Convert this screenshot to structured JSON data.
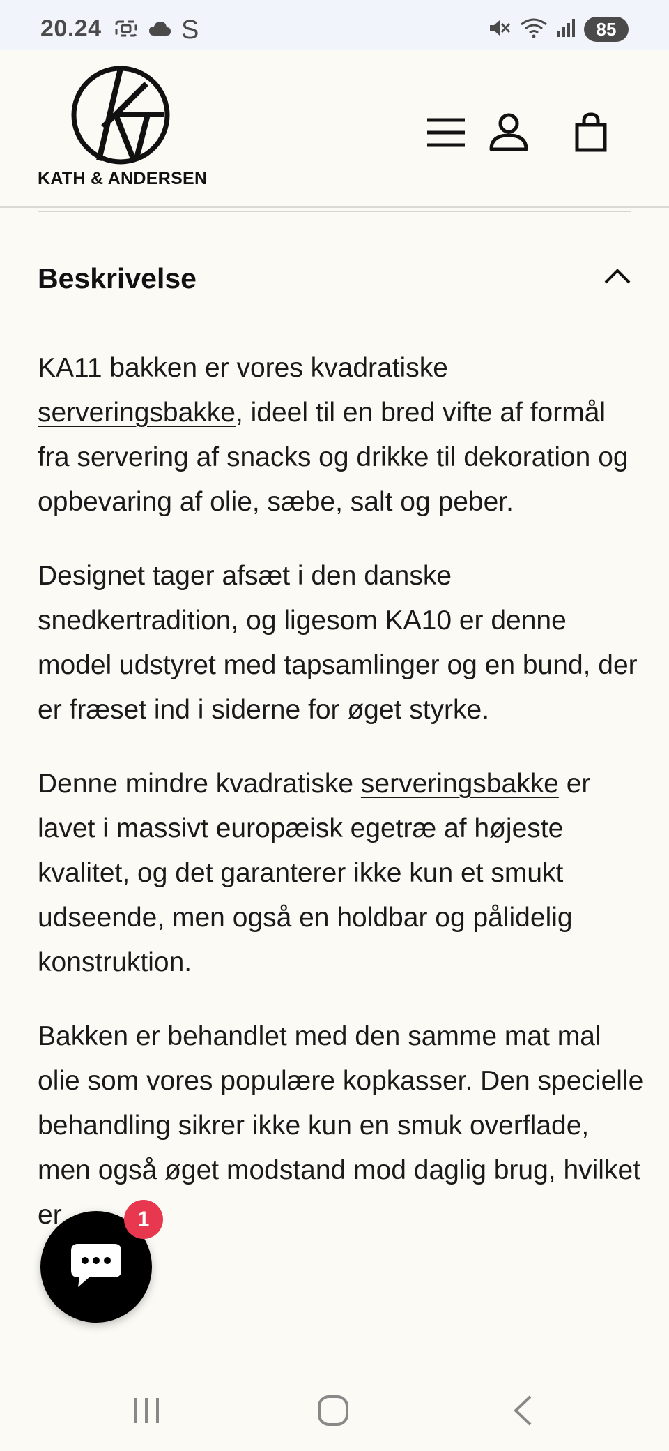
{
  "status_bar": {
    "time": "20.24",
    "s_glyph": "S",
    "battery": "85",
    "icons": [
      "screenshot-icon",
      "cloud-icon",
      "mute-icon",
      "wifi-icon",
      "signal-icon"
    ]
  },
  "header": {
    "logo_text": "KATH & ANDERSEN",
    "icons": [
      "menu-icon",
      "account-icon",
      "cart-icon"
    ]
  },
  "accordion": {
    "title": "Beskrivelse",
    "expanded": true,
    "chevron": "chevron-up-icon"
  },
  "description": {
    "p1": {
      "before": "KA11 bakken er vores kvadratiske ",
      "link": "serveringsbakke",
      "after": ", ideel til en bred vifte af formål fra servering af snacks og drikke til dekoration og opbevaring af olie, sæbe, salt og peber."
    },
    "p2": "Designet tager afsæt i den danske snedkertradition, og ligesom KA10 er denne model udstyret med tapsamlinger og en bund, der er fræset ind i siderne for øget styrke.",
    "p3": {
      "before": "Denne mindre kvadratiske ",
      "link": "serveringsbakke",
      "after": " er lavet i massivt europæisk egetræ af højeste kvalitet, og det garanterer ikke kun et smukt udseende, men også en holdbar og pålidelig konstruktion."
    },
    "p4": "Bakken er behandlet med den samme mat mal olie som vores populære kopkasser. Den specielle behandling sikrer ikke kun en smuk overflade, men også øget modstand mod daglig brug, hvilket er"
  },
  "chat_widget": {
    "badge_count": "1",
    "icon": "chat-bubble-icon"
  },
  "nav_bar": {
    "icons": [
      "recent-apps-icon",
      "home-icon",
      "back-icon"
    ]
  },
  "colors": {
    "background": "#fbfaf5",
    "status_bar": "#f2f4fb",
    "text": "#1a1a1a",
    "badge": "#e8384f",
    "chat": "#000000"
  }
}
